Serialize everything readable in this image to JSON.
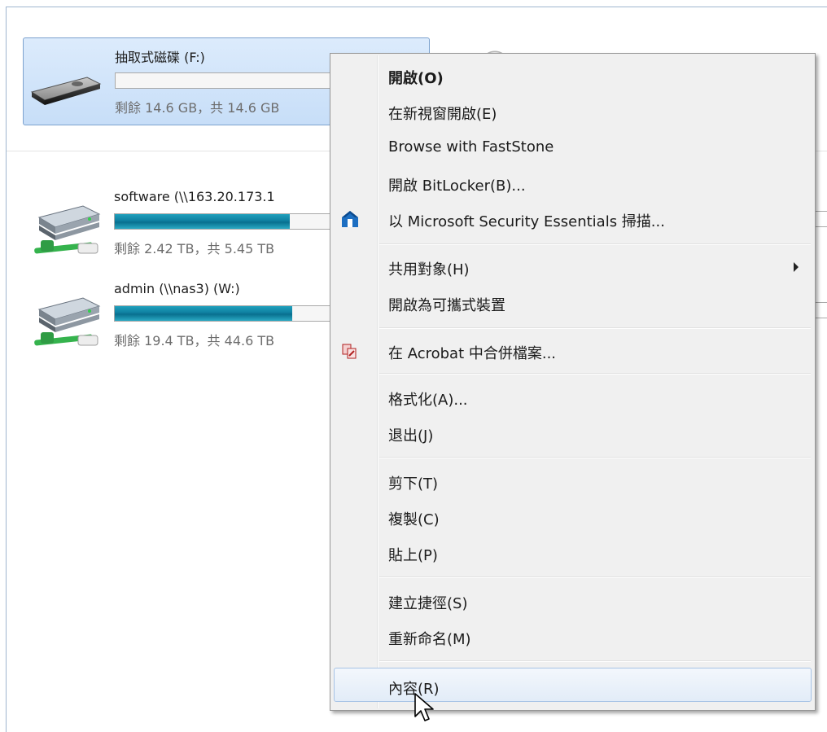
{
  "drives": {
    "removable": {
      "name": "抽取式磁碟 (F:)",
      "free_text": "剩餘 14.6 GB，共 14.6 GB",
      "usage_fraction": 0.0,
      "selected": true
    },
    "network": [
      {
        "name": "software (\\\\163.20.173.1",
        "free_text": "剩餘 2.42 TB，共 5.45 TB",
        "usage_fraction": 0.556
      },
      {
        "name": "admin (\\\\nas3) (W:)",
        "free_text": "剩餘 19.4 TB，共 44.6 TB",
        "usage_fraction": 0.565
      }
    ]
  },
  "context_menu": {
    "items": [
      {
        "id": "open",
        "label": "開啟(O)",
        "bold": true
      },
      {
        "id": "open-new-window",
        "label": "在新視窗開啟(E)"
      },
      {
        "id": "browse-faststone",
        "label": "Browse with FastStone"
      },
      {
        "id": "bitlocker",
        "label": "開啟 BitLocker(B)..."
      },
      {
        "id": "mse-scan",
        "label": "以 Microsoft Security Essentials 掃描...",
        "icon": "mse-shield-icon"
      },
      {
        "id": "share-with",
        "label": "共用對象(H)",
        "submenu": true
      },
      {
        "id": "open-portable",
        "label": "開啟為可攜式裝置"
      },
      {
        "id": "acrobat-combine",
        "label": "在 Acrobat 中合併檔案...",
        "icon": "acrobat-combine-icon"
      },
      {
        "id": "format",
        "label": "格式化(A)..."
      },
      {
        "id": "eject",
        "label": "退出(J)"
      },
      {
        "id": "cut",
        "label": "剪下(T)"
      },
      {
        "id": "copy",
        "label": "複製(C)"
      },
      {
        "id": "paste",
        "label": "貼上(P)"
      },
      {
        "id": "create-shortcut",
        "label": "建立捷徑(S)"
      },
      {
        "id": "rename",
        "label": "重新命名(M)"
      },
      {
        "id": "properties",
        "label": "內容(R)",
        "hover": true
      }
    ]
  },
  "colors": {
    "selection_fill": "#cfe3fa",
    "selection_border": "#7da2ce",
    "usage_bar": "#0f7fa0",
    "menu_bg": "#f0f0f0"
  }
}
